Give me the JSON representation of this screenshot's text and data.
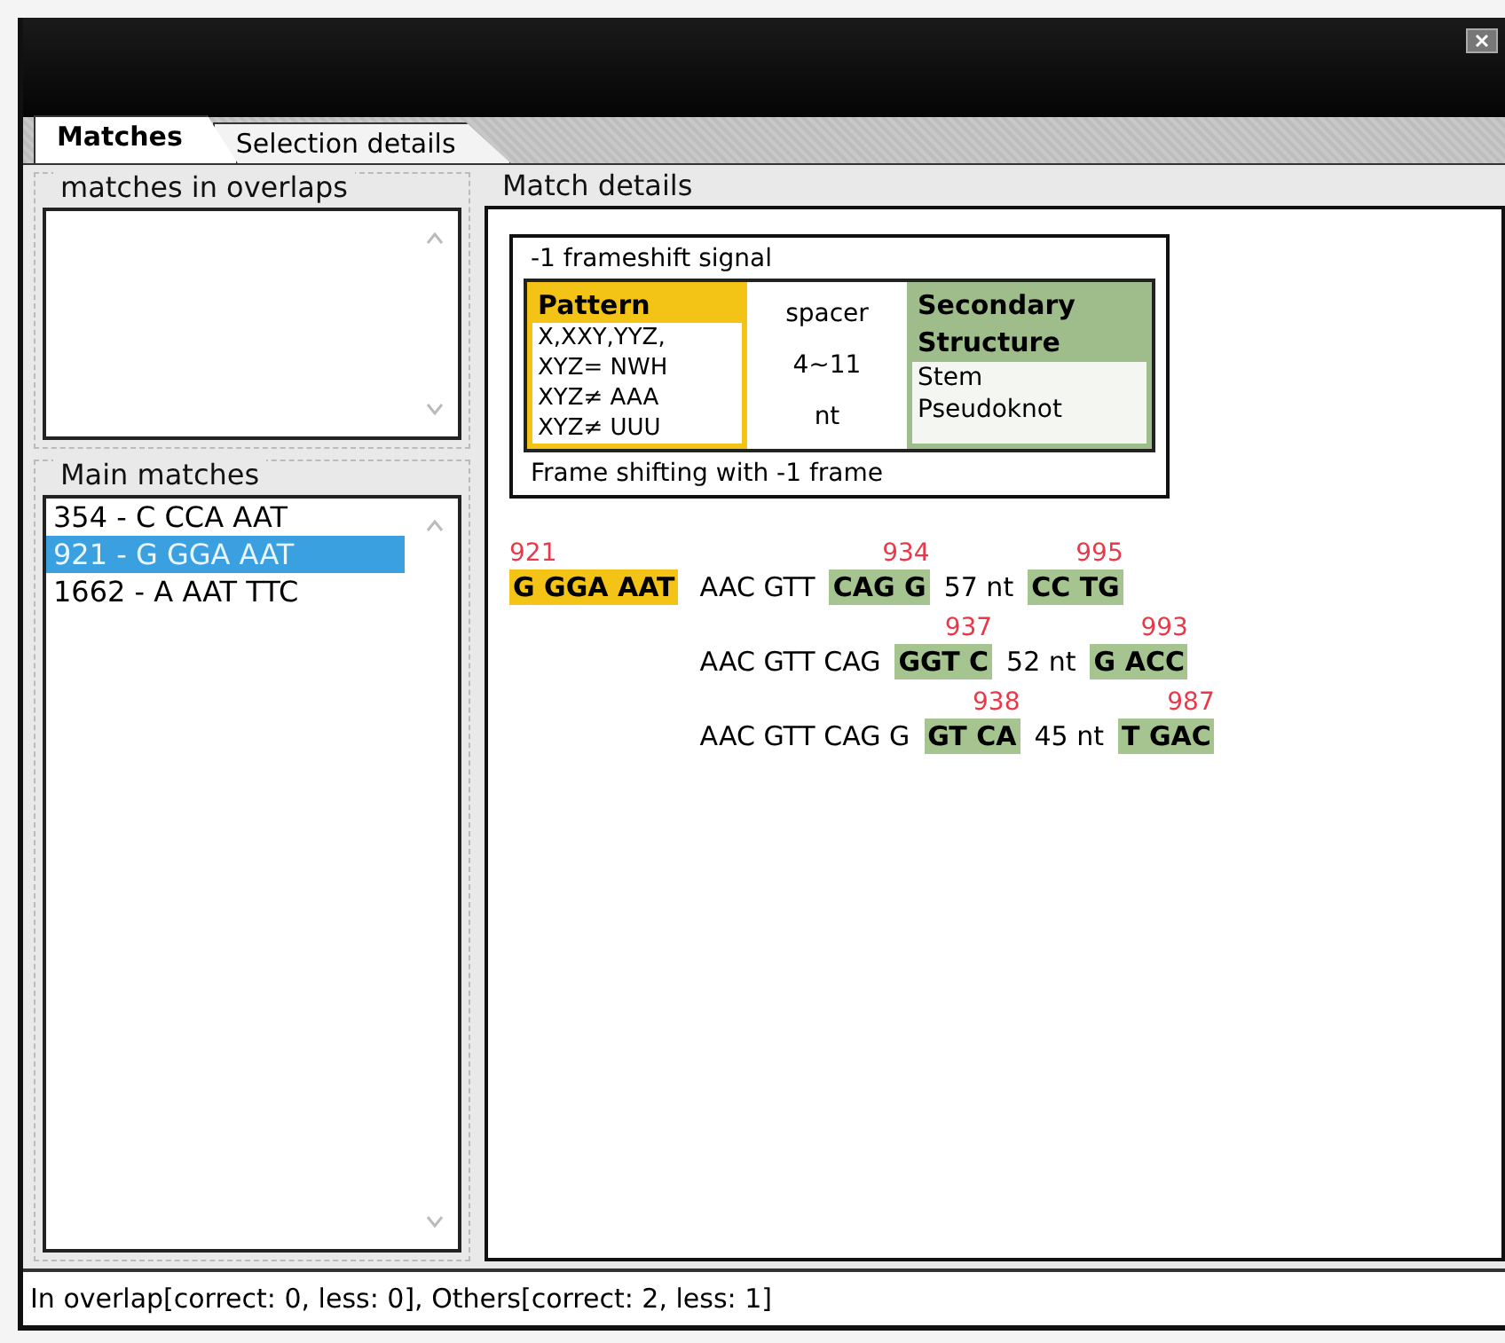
{
  "tabs": [
    {
      "label": "Matches",
      "selected": true
    },
    {
      "label": "Selection details",
      "selected": false
    }
  ],
  "overlaps": {
    "title": "matches in overlaps"
  },
  "main_matches": {
    "title": "Main matches",
    "items": [
      {
        "label": "354 - C CCA AAT",
        "selected": false
      },
      {
        "label": "921 - G GGA AAT",
        "selected": true
      },
      {
        "label": "1662 - A AAT TTC",
        "selected": false
      }
    ]
  },
  "match_details": {
    "title": "Match details",
    "signal": {
      "title": "-1 frameshift signal",
      "pattern": {
        "header": "Pattern",
        "lines": [
          "X,XXY,YYZ,",
          "XYZ= NWH",
          "XYZ≠ AAA",
          "XYZ≠ UUU"
        ]
      },
      "spacer": {
        "lines": [
          "spacer",
          "4~11",
          "nt"
        ]
      },
      "structure": {
        "header": "Secondary Structure",
        "lines": [
          "Stem",
          "Pseudoknot"
        ]
      },
      "footer": "Frame shifting with -1 frame"
    },
    "rows": [
      {
        "pattern": {
          "label": "921",
          "text": "G GGA AAT"
        },
        "segments": [
          {
            "kind": "plain",
            "text": "AAC GTT"
          },
          {
            "kind": "stem",
            "label": "934",
            "text": "CAG G"
          },
          {
            "kind": "plain",
            "text": "57 nt"
          },
          {
            "kind": "stem",
            "label": "995",
            "text": "CC TG"
          }
        ]
      },
      {
        "segments": [
          {
            "kind": "plain",
            "text": "AAC GTT CAG"
          },
          {
            "kind": "stem",
            "label": "937",
            "text": "GGT C"
          },
          {
            "kind": "plain",
            "text": "52 nt"
          },
          {
            "kind": "stem",
            "label": "993",
            "text": "G ACC"
          }
        ]
      },
      {
        "segments": [
          {
            "kind": "plain",
            "text": "AAC GTT CAG G"
          },
          {
            "kind": "stem",
            "label": "938",
            "text": "GT CA"
          },
          {
            "kind": "plain",
            "text": "45 nt"
          },
          {
            "kind": "stem",
            "label": "987",
            "text": "T GAC"
          }
        ]
      }
    ]
  },
  "status_bar": "In overlap[correct: 0, less: 0], Others[correct: 2, less: 1]"
}
